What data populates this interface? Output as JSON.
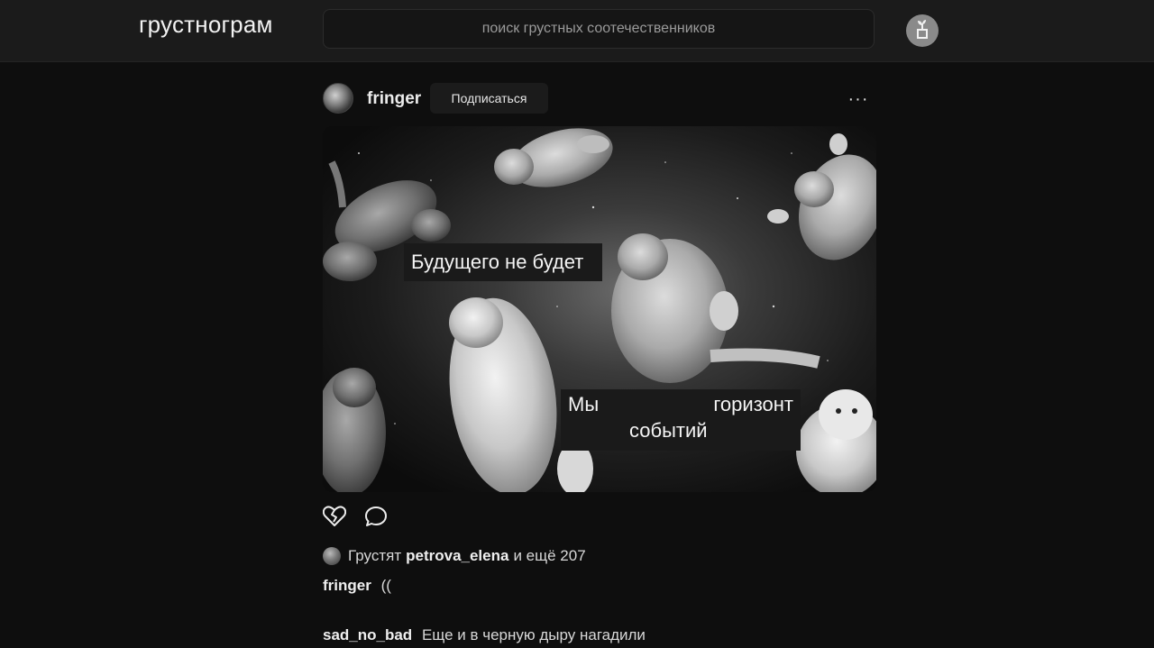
{
  "header": {
    "logo": "грустнограм",
    "search_placeholder": "поиск грустных соотечественников",
    "profile_icon": "plant-pot-icon"
  },
  "post": {
    "username": "fringer",
    "follow_label": "Подписаться",
    "more_icon": "more-horizontal-icon",
    "more_label": "···",
    "image": {
      "caption_top": "Будущего не будет",
      "caption_bottom_left": "Мы",
      "caption_bottom_right": "горизонт",
      "caption_bottom_second": "событий"
    },
    "actions": {
      "like_icon": "broken-heart-icon",
      "comment_icon": "comment-bubble-icon"
    },
    "likes": {
      "prefix": "Грустят",
      "user": "petrova_elena",
      "suffix": "и ещё 207"
    },
    "caption": {
      "user": "fringer",
      "text": "(("
    },
    "comments": [
      {
        "user": "sad_no_bad",
        "text": "Еще и в черную дыру нагадили"
      }
    ]
  },
  "colors": {
    "background": "#0e0e0e",
    "topbar": "#1b1b1b",
    "text": "#e8e8e8"
  }
}
